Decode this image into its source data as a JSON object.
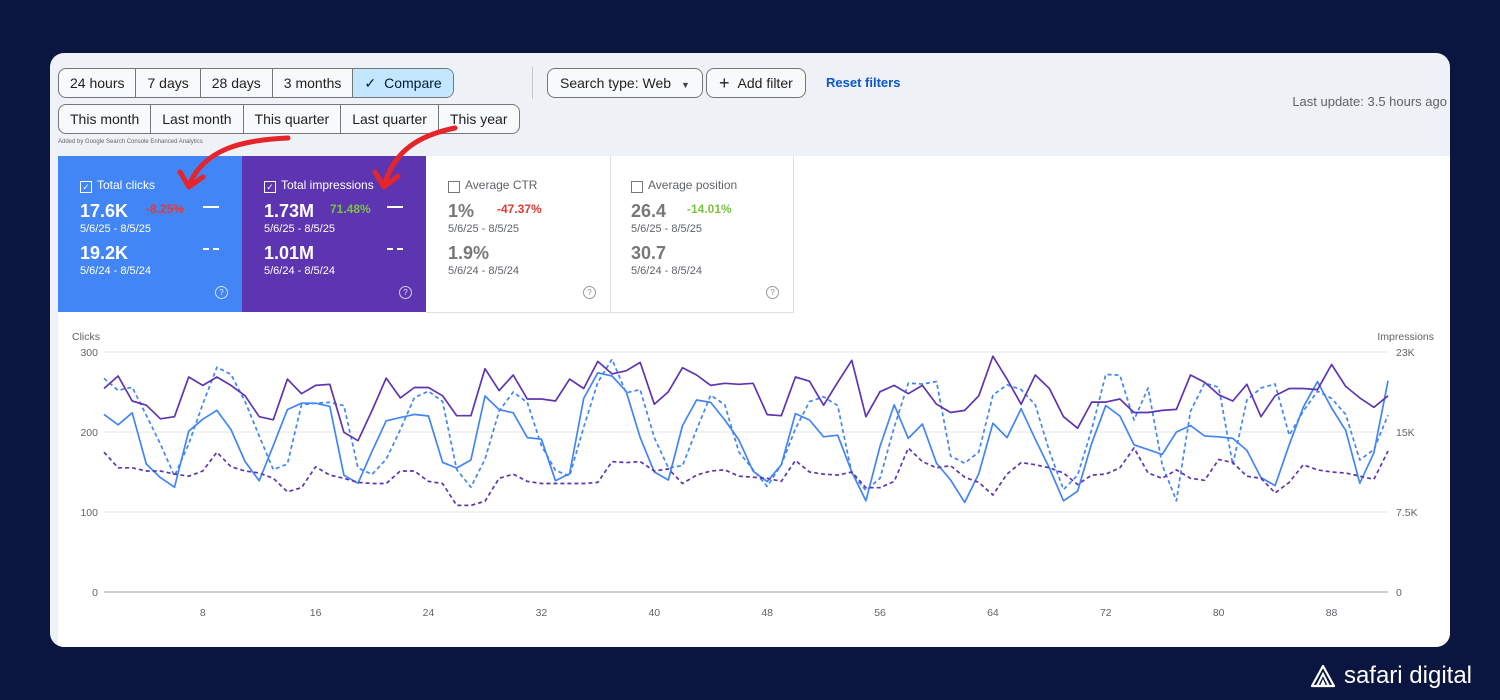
{
  "toolbar": {
    "date_ranges": [
      "24 hours",
      "7 days",
      "28 days",
      "3 months",
      "Compare"
    ],
    "compare_ranges": [
      "This month",
      "Last month",
      "This quarter",
      "Last quarter",
      "This year"
    ],
    "search_type": "Search type: Web",
    "add_filter": "Add filter",
    "reset_filters": "Reset filters",
    "last_update": "Last update: 3.5 hours ago",
    "added_by": "Added by Google Search Console Enhanced Analytics"
  },
  "colors": {
    "background": "#0b1640",
    "clicks": "#4285f4",
    "impressions": "#5e35b1",
    "arrow": "#e5252a",
    "positive": "#7cc242",
    "negative": "#e53935"
  },
  "cards": {
    "clicks": {
      "title": "Total clicks",
      "value": "17.6K",
      "change": "-8.25%",
      "date": "5/6/25 - 8/5/25",
      "prev_value": "19.2K",
      "prev_date": "5/6/24 - 8/5/24",
      "checked": true
    },
    "impressions": {
      "title": "Total impressions",
      "value": "1.73M",
      "change": "71.48%",
      "date": "5/6/25 - 8/5/25",
      "prev_value": "1.01M",
      "prev_date": "5/6/24 - 8/5/24",
      "checked": true
    },
    "ctr": {
      "title": "Average CTR",
      "value": "1%",
      "change": "-47.37%",
      "date": "5/6/25 - 8/5/25",
      "prev_value": "1.9%",
      "prev_date": "5/6/24 - 8/5/24",
      "checked": false
    },
    "position": {
      "title": "Average position",
      "value": "26.4",
      "change": "-14.01%",
      "date": "5/6/25 - 8/5/25",
      "prev_value": "30.7",
      "prev_date": "5/6/24 - 8/5/24",
      "checked": false
    }
  },
  "chart_data": {
    "type": "line",
    "ylabel_left": "Clicks",
    "ylabel_right": "Impressions",
    "y_left_ticks": [
      "0",
      "100",
      "200",
      "300"
    ],
    "y_right_ticks": [
      "0",
      "7.5K",
      "15K",
      "23K"
    ],
    "x_ticks": [
      "8",
      "16",
      "24",
      "32",
      "40",
      "48",
      "56",
      "64",
      "72",
      "80",
      "88"
    ],
    "ylim_left": [
      0,
      300
    ],
    "ylim_right": [
      0,
      23000
    ],
    "x": [
      1,
      2,
      3,
      4,
      5,
      6,
      7,
      8,
      9,
      10,
      11,
      12,
      13,
      14,
      15,
      16,
      17,
      18,
      19,
      20,
      21,
      22,
      23,
      24,
      25,
      26,
      27,
      28,
      29,
      30,
      31,
      32,
      33,
      34,
      35,
      36,
      37,
      38,
      39,
      40,
      41,
      42,
      43,
      44,
      45,
      46,
      47,
      48,
      49,
      50,
      51,
      52,
      53,
      54,
      55,
      56,
      57,
      58,
      59,
      60,
      61,
      62,
      63,
      64,
      65,
      66,
      67,
      68,
      69,
      70,
      71,
      72,
      73,
      74,
      75,
      76,
      77,
      78,
      79,
      80,
      81,
      82,
      83,
      84,
      85,
      86,
      87,
      88,
      89,
      90,
      91,
      92
    ],
    "series": [
      {
        "name": "Clicks",
        "axis": "left",
        "style": "solid",
        "values": [
          222,
          209,
          224,
          160,
          143,
          131,
          201,
          216,
          227,
          203,
          163,
          139,
          183,
          228,
          236,
          236,
          232,
          146,
          136,
          176,
          214,
          218,
          222,
          220,
          162,
          155,
          165,
          245,
          228,
          224,
          193,
          191,
          139,
          148,
          242,
          274,
          270,
          251,
          193,
          150,
          140,
          208,
          240,
          237,
          215,
          190,
          151,
          138,
          159,
          223,
          215,
          194,
          196,
          150,
          114,
          182,
          234,
          192,
          210,
          161,
          140,
          112,
          148,
          211,
          193,
          229,
          191,
          155,
          114,
          126,
          186,
          233,
          220,
          184,
          178,
          172,
          200,
          208,
          195,
          194,
          192,
          177,
          143,
          133,
          184,
          231,
          263,
          230,
          202,
          136,
          174,
          264
        ]
      },
      {
        "name": "Clicks (previous period)",
        "axis": "left",
        "style": "dashed",
        "values": [
          267,
          252,
          256,
          221,
          185,
          145,
          185,
          235,
          281,
          272,
          238,
          195,
          153,
          160,
          234,
          236,
          237,
          233,
          155,
          147,
          166,
          203,
          243,
          251,
          238,
          153,
          131,
          166,
          226,
          250,
          237,
          183,
          152,
          145,
          206,
          262,
          291,
          249,
          253,
          193,
          155,
          158,
          203,
          246,
          234,
          175,
          153,
          132,
          159,
          204,
          238,
          244,
          233,
          148,
          127,
          142,
          206,
          261,
          260,
          263,
          170,
          161,
          175,
          246,
          259,
          253,
          234,
          176,
          128,
          146,
          203,
          272,
          271,
          215,
          255,
          159,
          114,
          226,
          261,
          256,
          159,
          240,
          255,
          260,
          196,
          226,
          251,
          242,
          222,
          165,
          178,
          221
        ]
      },
      {
        "name": "Impressions",
        "axis": "right",
        "style": "solid",
        "values": [
          19500,
          20700,
          18300,
          17900,
          16600,
          16800,
          20600,
          19800,
          20600,
          19800,
          18800,
          16800,
          16500,
          20400,
          19000,
          19800,
          19900,
          15300,
          14500,
          17400,
          20500,
          18600,
          19600,
          19600,
          18800,
          16900,
          16900,
          21400,
          19300,
          20800,
          18500,
          18500,
          18300,
          20400,
          19500,
          22100,
          20900,
          21200,
          22000,
          18000,
          19200,
          21500,
          20800,
          19800,
          20000,
          19900,
          20000,
          17000,
          16900,
          20600,
          20200,
          17900,
          20100,
          22200,
          16800,
          19200,
          19800,
          19000,
          19800,
          18000,
          17200,
          17400,
          18800,
          22600,
          20400,
          18000,
          20800,
          19500,
          16800,
          15700,
          18200,
          18200,
          18500,
          17200,
          17200,
          17400,
          17500,
          20800,
          20100,
          18900,
          18300,
          19900,
          16800,
          18800,
          19500,
          19500,
          19400,
          21800,
          19700,
          18600,
          17700,
          18800
        ]
      },
      {
        "name": "Impressions (previous period)",
        "axis": "right",
        "style": "dashed",
        "values": [
          13400,
          11900,
          11900,
          11600,
          11600,
          11300,
          11100,
          11600,
          13400,
          12000,
          11600,
          11400,
          10900,
          9600,
          10000,
          12000,
          11200,
          10900,
          10500,
          10400,
          10400,
          11600,
          11600,
          10600,
          10400,
          8300,
          8300,
          8700,
          10900,
          11300,
          10600,
          10400,
          10400,
          10400,
          10400,
          10500,
          12500,
          12400,
          12500,
          11600,
          11800,
          10400,
          11200,
          11600,
          11700,
          11100,
          11000,
          10900,
          10600,
          12600,
          11500,
          11300,
          11200,
          11500,
          10000,
          10000,
          10600,
          13800,
          12500,
          11900,
          12100,
          11000,
          10500,
          9300,
          11300,
          12400,
          12200,
          11900,
          11400,
          10300,
          11200,
          11300,
          11900,
          13800,
          11400,
          10900,
          11700,
          10900,
          10700,
          12700,
          12400,
          11100,
          10900,
          9500,
          10500,
          12200,
          11700,
          11500,
          11400,
          11100,
          10800,
          13500
        ]
      }
    ]
  },
  "brand": {
    "name": "safari digital"
  }
}
